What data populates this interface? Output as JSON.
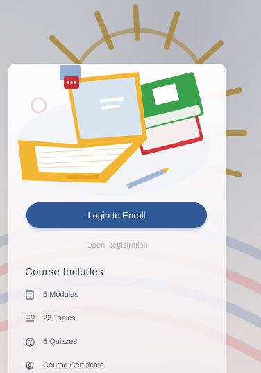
{
  "enroll": {
    "login_label": "Login to Enroll",
    "registration_status": "Open Registration"
  },
  "course_includes": {
    "title": "Course Includes",
    "items": [
      {
        "icon": "book-icon",
        "label": "5 Modules"
      },
      {
        "icon": "list-icon",
        "label": "23 Topics"
      },
      {
        "icon": "question-icon",
        "label": "5 Quizzes"
      },
      {
        "icon": "certificate-icon",
        "label": "Course Certificate"
      }
    ]
  },
  "colors": {
    "button": "#2e5896",
    "sun_rays": "#b08a2e",
    "laptop": "#f2b632",
    "book_green": "#3aa24a",
    "book_red": "#d8343b"
  }
}
